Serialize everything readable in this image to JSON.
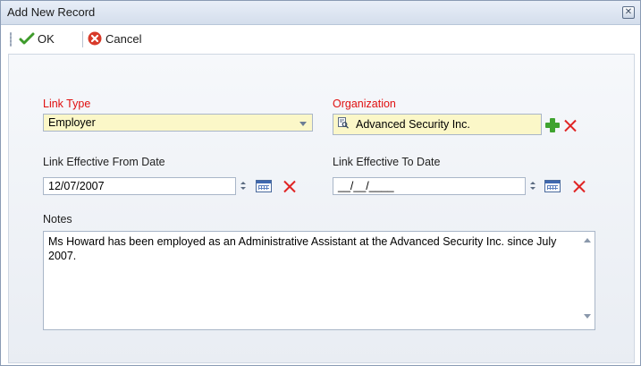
{
  "window": {
    "title": "Add New Record"
  },
  "toolbar": {
    "ok_label": "OK",
    "cancel_label": "Cancel"
  },
  "form": {
    "link_type": {
      "label": "Link Type",
      "value": "Employer"
    },
    "organization": {
      "label": "Organization",
      "value": "Advanced Security Inc."
    },
    "from_date": {
      "label": "Link Effective From Date",
      "value": "12/07/2007"
    },
    "to_date": {
      "label": "Link Effective To Date",
      "value": "__/__/____"
    },
    "notes": {
      "label": "Notes",
      "value": "Ms Howard has been employed as an Administrative Assistant at the Advanced Security Inc. since July 2007."
    }
  },
  "colors": {
    "required_label": "#e01010",
    "highlight_field": "#fbf7c8",
    "add_green": "#3fa32f",
    "clear_red": "#e02424"
  },
  "icons": [
    "close-icon",
    "checkmark-icon",
    "cancel-icon",
    "chevron-down-icon",
    "lookup-icon",
    "add-icon",
    "clear-icon",
    "calendar-icon",
    "spin-icon",
    "scroll-up-icon",
    "scroll-down-icon"
  ]
}
